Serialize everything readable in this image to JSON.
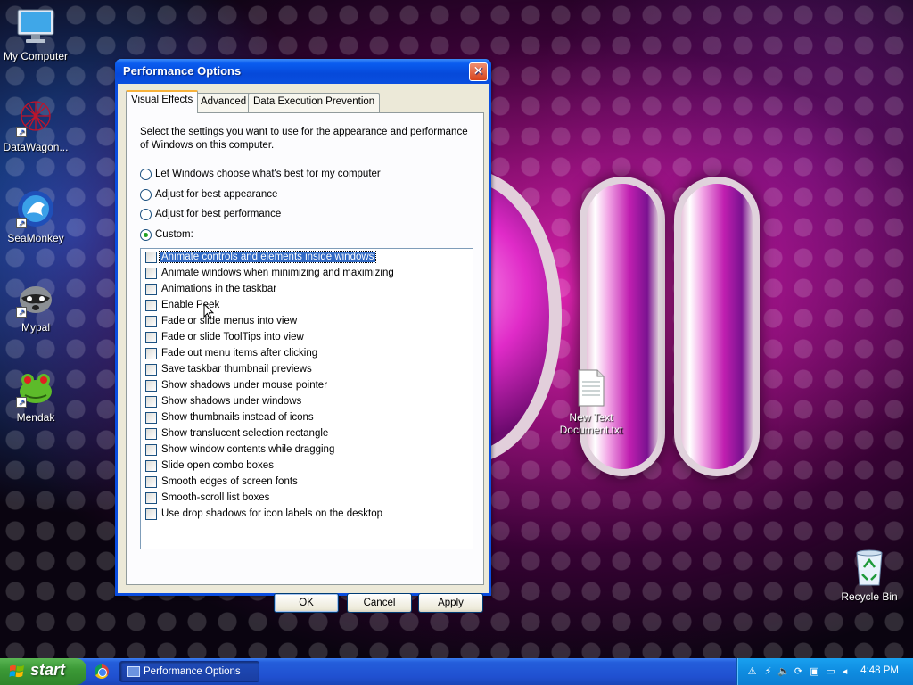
{
  "desktop": {
    "icons": [
      {
        "label": "My Computer"
      },
      {
        "label": "DataWagon..."
      },
      {
        "label": "SeaMonkey"
      },
      {
        "label": "Mypal"
      },
      {
        "label": "Mendak"
      },
      {
        "label": "New Text Document.txt"
      },
      {
        "label": "Recycle Bin"
      }
    ]
  },
  "dialog": {
    "title": "Performance Options",
    "close_glyph": "✕",
    "tabs": [
      {
        "label": "Visual Effects",
        "active": true
      },
      {
        "label": "Advanced",
        "active": false
      },
      {
        "label": "Data Execution Prevention",
        "active": false
      }
    ],
    "description": "Select the settings you want to use for the appearance and performance of Windows on this computer.",
    "radios": [
      {
        "label": "Let Windows choose what's best for my computer",
        "checked": false
      },
      {
        "label": "Adjust for best appearance",
        "checked": false
      },
      {
        "label": "Adjust for best performance",
        "checked": false
      },
      {
        "label": "Custom:",
        "checked": true
      }
    ],
    "effects": [
      {
        "label": "Animate controls and elements inside windows",
        "checked": false,
        "selected": true
      },
      {
        "label": "Animate windows when minimizing and maximizing",
        "checked": false
      },
      {
        "label": "Animations in the taskbar",
        "checked": false
      },
      {
        "label": "Enable Peek",
        "checked": false
      },
      {
        "label": "Fade or slide menus into view",
        "checked": false
      },
      {
        "label": "Fade or slide ToolTips into view",
        "checked": false
      },
      {
        "label": "Fade out menu items after clicking",
        "checked": false
      },
      {
        "label": "Save taskbar thumbnail previews",
        "checked": false
      },
      {
        "label": "Show shadows under mouse pointer",
        "checked": false
      },
      {
        "label": "Show shadows under windows",
        "checked": false
      },
      {
        "label": "Show thumbnails instead of icons",
        "checked": false
      },
      {
        "label": "Show translucent selection rectangle",
        "checked": false
      },
      {
        "label": "Show window contents while dragging",
        "checked": false
      },
      {
        "label": "Slide open combo boxes",
        "checked": false
      },
      {
        "label": "Smooth edges of screen fonts",
        "checked": false
      },
      {
        "label": "Smooth-scroll list boxes",
        "checked": false
      },
      {
        "label": "Use drop shadows for icon labels on the desktop",
        "checked": false
      }
    ],
    "buttons": {
      "ok": "OK",
      "cancel": "Cancel",
      "apply": "Apply"
    }
  },
  "taskbar": {
    "start_label": "start",
    "task_item": "Performance Options",
    "clock": "4:48 PM"
  },
  "colors": {
    "title_bar": "#0a4de0",
    "dialog_face": "#ece9d8",
    "selection": "#316ac5",
    "taskbar": "#245edb",
    "start_button": "#3c9a37",
    "tray": "#0f8ce0"
  }
}
